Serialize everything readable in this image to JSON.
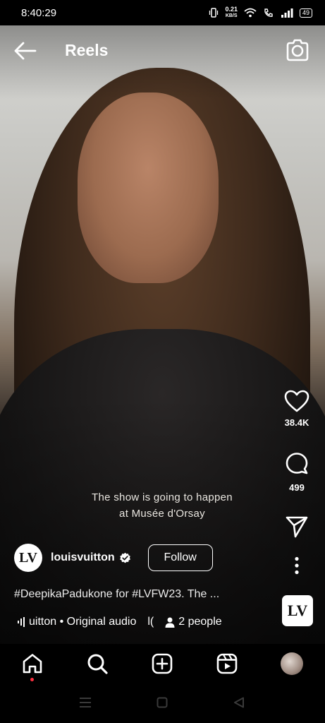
{
  "status_bar": {
    "time": "8:40:29",
    "speed_value": "0.21",
    "speed_unit": "KB/S",
    "battery": "49"
  },
  "header": {
    "title": "Reels"
  },
  "video": {
    "subtitle_lines": [
      "The show is going to happen",
      "at Musée d'Orsay"
    ]
  },
  "actions": {
    "likes": "38.4K",
    "comments": "499"
  },
  "post": {
    "username": "louisvuitton",
    "avatar_monogram": "LV",
    "follow_label": "Follow",
    "description": "#DeepikaPadukone for #LVFW23. The ...",
    "audio_text": "uitton • Original audio",
    "audio_truncated": "l(",
    "people": "2 people"
  },
  "icons": {
    "status": [
      "vibrate-icon",
      "wifi-icon",
      "volte-call-icon",
      "signal-icon",
      "battery-icon"
    ],
    "header": [
      "back-arrow-icon",
      "camera-icon"
    ],
    "actions": [
      "heart-icon",
      "comment-icon",
      "send-icon",
      "more-icon"
    ],
    "nav": [
      "home-icon",
      "search-icon",
      "create-icon",
      "reels-icon",
      "profile-avatar"
    ],
    "system": [
      "recents-icon",
      "home-square-icon",
      "back-triangle-icon"
    ]
  },
  "colors": {
    "notification_dot": "#ff3040",
    "background": "#000000"
  }
}
